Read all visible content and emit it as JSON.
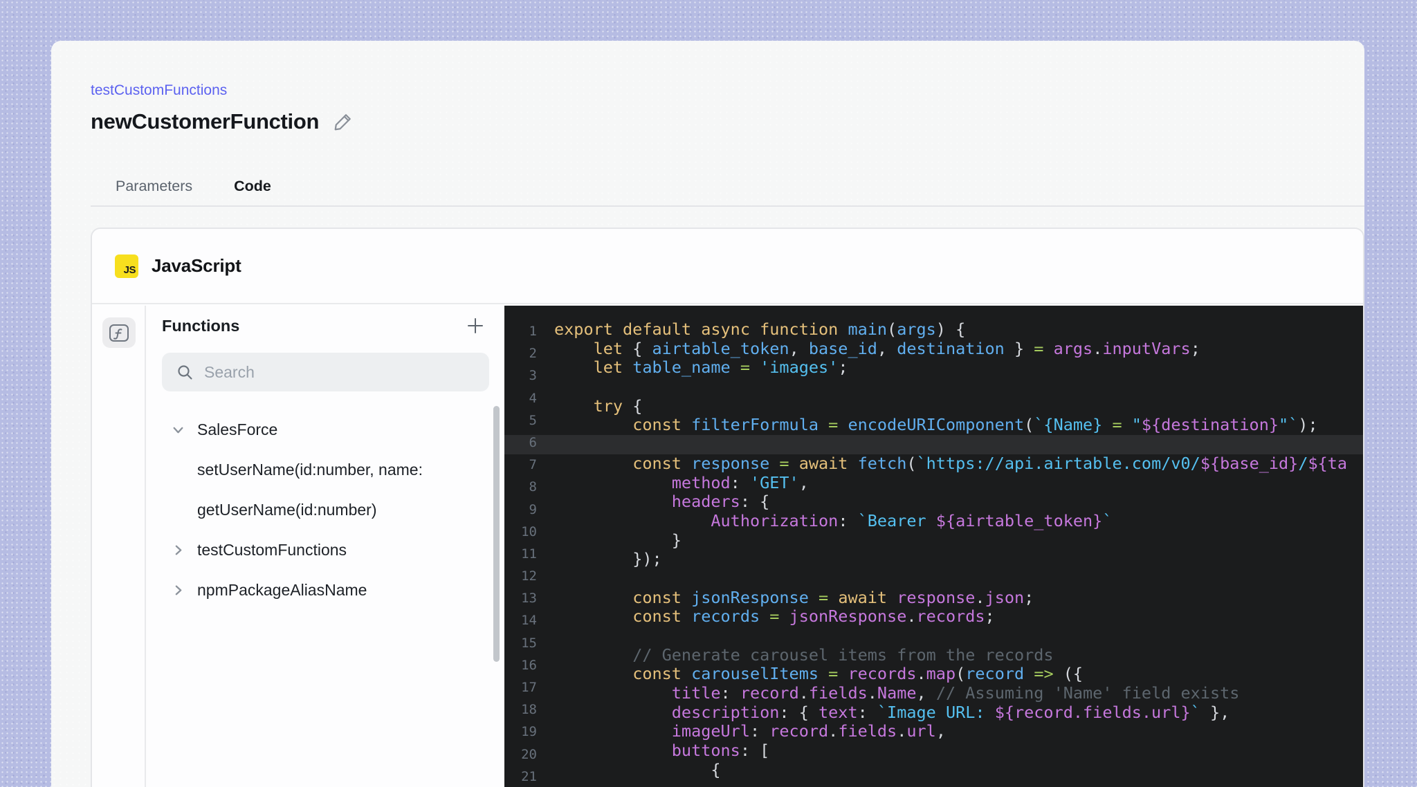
{
  "page": {
    "background_color": "#b6bce3",
    "surface_color": "#f6f7f7",
    "accent_color": "#5c62f0"
  },
  "breadcrumb": {
    "label": "testCustomFunctions",
    "color": "#5c62f0"
  },
  "header": {
    "title": "newCustomerFunction",
    "edit_icon": "pencil-icon"
  },
  "tabs": [
    {
      "label": "Parameters",
      "active": false
    },
    {
      "label": "Code",
      "active": true
    }
  ],
  "card": {
    "language_label": "JavaScript",
    "badge_text": "JS",
    "badge_color": "#f7df1e",
    "rail_icon": "function-icon"
  },
  "sidebar": {
    "title": "Functions",
    "add_button_icon": "plus-icon",
    "search": {
      "placeholder": "Search",
      "value": "",
      "icon": "search-icon"
    },
    "items": [
      {
        "label": "SalesForce",
        "chevron": "down"
      },
      {
        "label": "setUserName(id:number, name:",
        "chevron": "none"
      },
      {
        "label": "getUserName(id:number)",
        "chevron": "none"
      },
      {
        "label": "testCustomFunctions",
        "chevron": "right"
      },
      {
        "label": "npmPackageAliasName",
        "chevron": "right"
      }
    ]
  },
  "editor": {
    "background": "#1b1c1d",
    "active_line_color": "#2c2d2f",
    "active_line_row": 7,
    "gutter_color": "#68717c",
    "gutter_numbers": [
      "1",
      "2",
      "3",
      "4",
      "5",
      "6",
      "7",
      "8",
      "9",
      "10",
      "11",
      "12",
      "13",
      "14",
      "15",
      "16",
      "17",
      "18",
      "19",
      "20",
      "21"
    ],
    "syntax_colors": {
      "kw": "#e5c07b",
      "var": "#61afef",
      "str": "#55c0f0",
      "op": "#a6cc5e",
      "prop": "#c678dd",
      "pn": "#d6d9de",
      "cm": "#5d666e"
    },
    "lines": [
      {
        "spans": [
          [
            "export default async function ",
            "kw"
          ],
          [
            "main",
            "var"
          ],
          [
            "(",
            "pn"
          ],
          [
            "args",
            "var"
          ],
          [
            ") {",
            "pn"
          ]
        ]
      },
      {
        "spans": [
          [
            "    ",
            "pn"
          ],
          [
            "let ",
            "kw"
          ],
          [
            "{ ",
            "pn"
          ],
          [
            "airtable_token",
            "var"
          ],
          [
            ", ",
            "pn"
          ],
          [
            "base_id",
            "var"
          ],
          [
            ", ",
            "pn"
          ],
          [
            "destination",
            "var"
          ],
          [
            " } ",
            "pn"
          ],
          [
            "= ",
            "op"
          ],
          [
            "args",
            "prop"
          ],
          [
            ".",
            "pn"
          ],
          [
            "inputVars",
            "prop"
          ],
          [
            ";",
            "pn"
          ]
        ]
      },
      {
        "spans": [
          [
            "    ",
            "pn"
          ],
          [
            "let ",
            "kw"
          ],
          [
            "table_name ",
            "var"
          ],
          [
            "= ",
            "op"
          ],
          [
            "'images'",
            "str"
          ],
          [
            ";",
            "pn"
          ]
        ]
      },
      {
        "spans": []
      },
      {
        "spans": [
          [
            "    ",
            "pn"
          ],
          [
            "try ",
            "kw"
          ],
          [
            "{",
            "pn"
          ]
        ]
      },
      {
        "spans": [
          [
            "        ",
            "pn"
          ],
          [
            "const ",
            "kw"
          ],
          [
            "filterFormula ",
            "var"
          ],
          [
            "= ",
            "op"
          ],
          [
            "encodeURIComponent",
            "var"
          ],
          [
            "(",
            "pn"
          ],
          [
            "`{Name} ",
            "str"
          ],
          [
            "= ",
            "op"
          ],
          [
            "\"",
            "str"
          ],
          [
            "${destination}",
            "prop"
          ],
          [
            "\"`",
            "str"
          ],
          [
            ");",
            "pn"
          ]
        ]
      },
      {
        "spans": [],
        "highlight": true
      },
      {
        "spans": [
          [
            "        ",
            "pn"
          ],
          [
            "const ",
            "kw"
          ],
          [
            "response ",
            "var"
          ],
          [
            "= ",
            "op"
          ],
          [
            "await ",
            "kw"
          ],
          [
            "fetch",
            "var"
          ],
          [
            "(",
            "pn"
          ],
          [
            "`https://api.airtable.com/v0/",
            "str"
          ],
          [
            "${base_id}",
            "prop"
          ],
          [
            "/",
            "str"
          ],
          [
            "${ta",
            "prop"
          ]
        ]
      },
      {
        "spans": [
          [
            "            ",
            "pn"
          ],
          [
            "method",
            "prop"
          ],
          [
            ": ",
            "pn"
          ],
          [
            "'GET'",
            "str"
          ],
          [
            ",",
            "pn"
          ]
        ]
      },
      {
        "spans": [
          [
            "            ",
            "pn"
          ],
          [
            "headers",
            "prop"
          ],
          [
            ": {",
            "pn"
          ]
        ]
      },
      {
        "spans": [
          [
            "                ",
            "pn"
          ],
          [
            "Authorization",
            "prop"
          ],
          [
            ": ",
            "pn"
          ],
          [
            "`Bearer ",
            "str"
          ],
          [
            "${airtable_token}",
            "prop"
          ],
          [
            "`",
            "str"
          ]
        ]
      },
      {
        "spans": [
          [
            "            ",
            "pn"
          ],
          [
            "}",
            "pn"
          ]
        ]
      },
      {
        "spans": [
          [
            "        ",
            "pn"
          ],
          [
            "});",
            "pn"
          ]
        ]
      },
      {
        "spans": []
      },
      {
        "spans": [
          [
            "        ",
            "pn"
          ],
          [
            "const ",
            "kw"
          ],
          [
            "jsonResponse ",
            "var"
          ],
          [
            "= ",
            "op"
          ],
          [
            "await ",
            "kw"
          ],
          [
            "response",
            "prop"
          ],
          [
            ".",
            "pn"
          ],
          [
            "json",
            "prop"
          ],
          [
            ";",
            "pn"
          ]
        ]
      },
      {
        "spans": [
          [
            "        ",
            "pn"
          ],
          [
            "const ",
            "kw"
          ],
          [
            "records ",
            "var"
          ],
          [
            "= ",
            "op"
          ],
          [
            "jsonResponse",
            "prop"
          ],
          [
            ".",
            "pn"
          ],
          [
            "records",
            "prop"
          ],
          [
            ";",
            "pn"
          ]
        ]
      },
      {
        "spans": []
      },
      {
        "spans": [
          [
            "        ",
            "pn"
          ],
          [
            "// Generate carousel items from the records",
            "cm"
          ]
        ]
      },
      {
        "spans": [
          [
            "        ",
            "pn"
          ],
          [
            "const ",
            "kw"
          ],
          [
            "carouselItems ",
            "var"
          ],
          [
            "= ",
            "op"
          ],
          [
            "records",
            "prop"
          ],
          [
            ".",
            "pn"
          ],
          [
            "map",
            "prop"
          ],
          [
            "(",
            "pn"
          ],
          [
            "record ",
            "var"
          ],
          [
            "=> ",
            "op"
          ],
          [
            "({",
            "pn"
          ]
        ]
      },
      {
        "spans": [
          [
            "            ",
            "pn"
          ],
          [
            "title",
            "prop"
          ],
          [
            ": ",
            "pn"
          ],
          [
            "record",
            "prop"
          ],
          [
            ".",
            "pn"
          ],
          [
            "fields",
            "prop"
          ],
          [
            ".",
            "pn"
          ],
          [
            "Name",
            "prop"
          ],
          [
            ", ",
            "pn"
          ],
          [
            "// Assuming 'Name' field exists",
            "cm"
          ]
        ]
      },
      {
        "spans": [
          [
            "            ",
            "pn"
          ],
          [
            "description",
            "prop"
          ],
          [
            ": { ",
            "pn"
          ],
          [
            "text",
            "prop"
          ],
          [
            ": ",
            "pn"
          ],
          [
            "`Image URL: ",
            "str"
          ],
          [
            "${record.fields.url}",
            "prop"
          ],
          [
            "`",
            "str"
          ],
          [
            " },",
            "pn"
          ]
        ]
      },
      {
        "spans": [
          [
            "            ",
            "pn"
          ],
          [
            "imageUrl",
            "prop"
          ],
          [
            ": ",
            "pn"
          ],
          [
            "record",
            "prop"
          ],
          [
            ".",
            "pn"
          ],
          [
            "fields",
            "prop"
          ],
          [
            ".",
            "pn"
          ],
          [
            "url",
            "prop"
          ],
          [
            ",",
            "pn"
          ]
        ]
      },
      {
        "spans": [
          [
            "            ",
            "pn"
          ],
          [
            "buttons",
            "prop"
          ],
          [
            ": [",
            "pn"
          ]
        ]
      },
      {
        "spans": [
          [
            "                ",
            "pn"
          ],
          [
            "{",
            "pn"
          ]
        ]
      }
    ]
  }
}
